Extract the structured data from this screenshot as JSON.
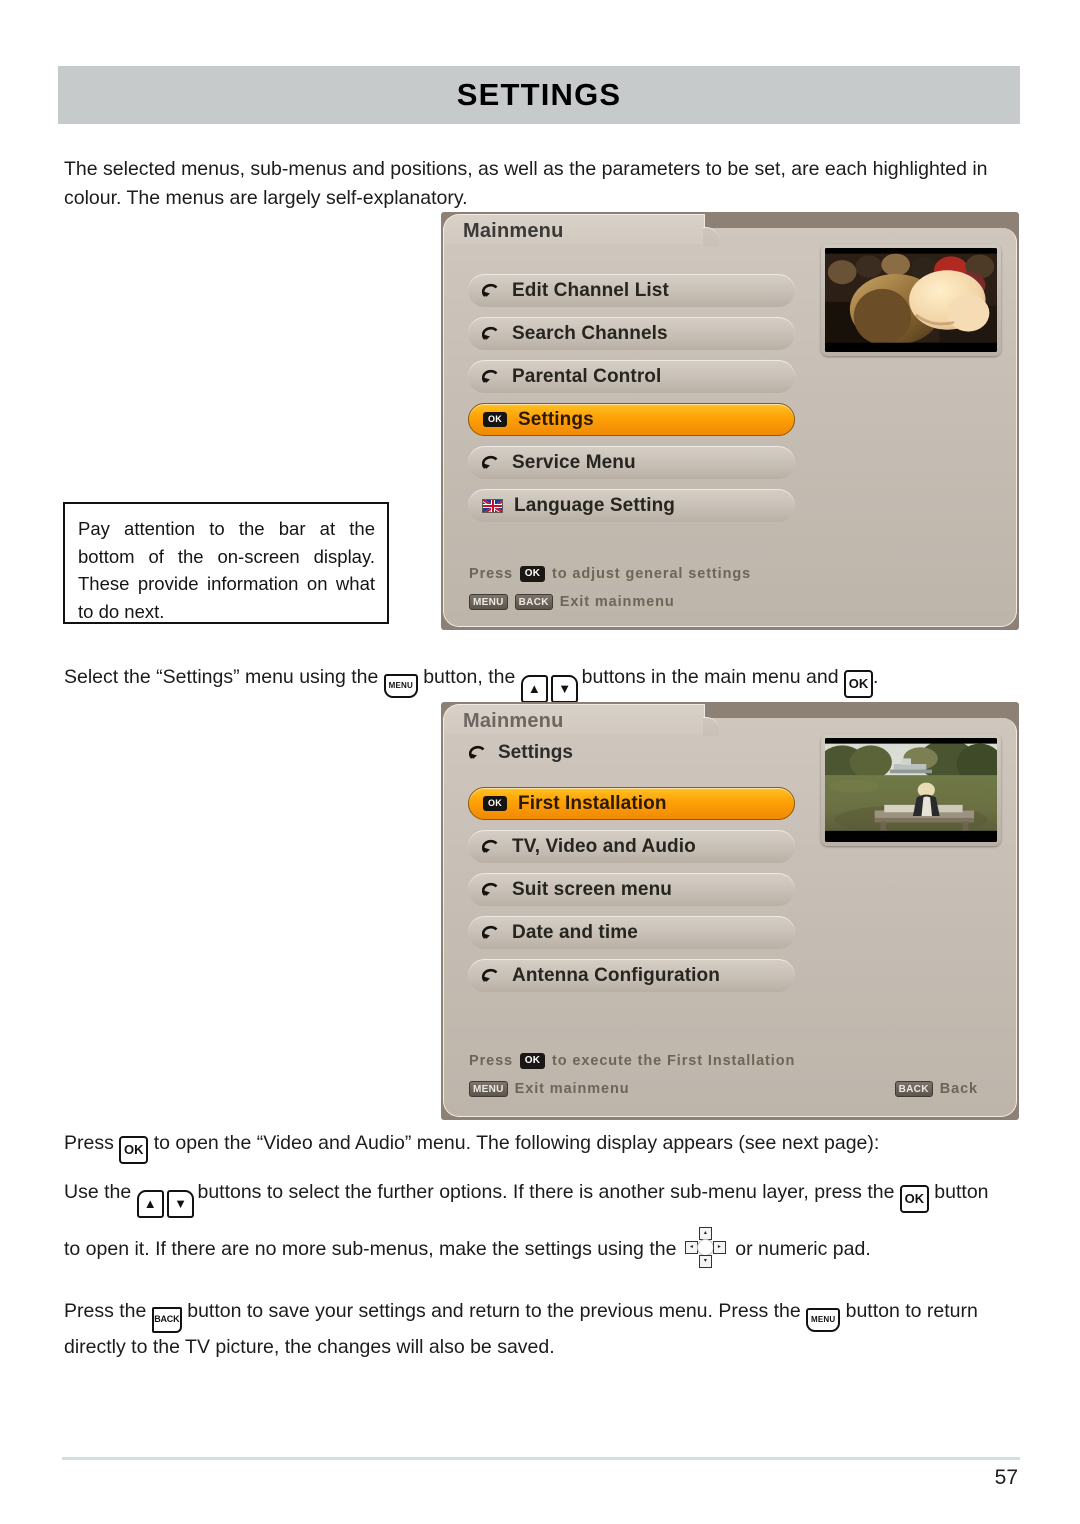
{
  "document": {
    "section_title": "SETTINGS",
    "page_number": "57",
    "intro_paragraph": "The selected menus, sub-menus and positions, as well as the parameters to be set, are each highlighted in colour. The menus are largely self-explanatory.",
    "note_box": "Pay attention to the bar at the bottom of the on-screen display. These provide information on what to do next.",
    "instructions": {
      "select_settings": {
        "part1": "Select the “Settings” menu using the",
        "part2": "button, the",
        "part3": "buttons in the main menu and",
        "part4": "."
      },
      "press_ok": {
        "part1": "Press",
        "part2": "to open the “Video and Audio” menu. The following display appears (see next page):"
      },
      "use_buttons": {
        "part1": "Use the",
        "part2": "buttons to select the further options. If there is another sub-menu layer, press the",
        "part3": "button"
      },
      "open_it": {
        "part1": "to open it. If there are no more sub-menus, make the settings using the",
        "part2": "or numeric pad."
      },
      "save_return": {
        "part1": "Press the",
        "part2": "button to save your settings and return to the previous menu. Press the",
        "part3": "button to return directly to the TV picture, the changes will also be saved."
      }
    },
    "keys": {
      "menu": "MENU",
      "ok": "OK",
      "back": "BACK",
      "up": "▲",
      "down": "▼",
      "navpad_up": "▴",
      "navpad_down": "▾",
      "navpad_left": "◂",
      "navpad_right": "▸"
    }
  },
  "osd_mainmenu": {
    "title": "Mainmenu",
    "items": [
      {
        "label": "Edit Channel List",
        "icon": "arrow-loop-icon",
        "selected": false
      },
      {
        "label": "Search Channels",
        "icon": "arrow-loop-icon",
        "selected": false
      },
      {
        "label": "Parental Control",
        "icon": "arrow-loop-icon",
        "selected": false
      },
      {
        "label": "Settings",
        "icon": "ok-badge-icon",
        "selected": true
      },
      {
        "label": "Service Menu",
        "icon": "arrow-loop-icon",
        "selected": false
      },
      {
        "label": "Language Setting",
        "icon": "uk-flag-icon",
        "selected": false
      }
    ],
    "status": {
      "line1_prefix": "Press",
      "line1_key": "OK",
      "line1_suffix": "to adjust general settings",
      "line2_key1": "MENU",
      "line2_key2": "BACK",
      "line2_text": "Exit mainmenu"
    },
    "preview": "crowd-scene-thumbnail",
    "colors": {
      "highlight": "#ffa207",
      "panel": "#c6beb4",
      "frame": "#8d8176"
    }
  },
  "osd_settings": {
    "title": "Mainmenu",
    "breadcrumb": "Settings",
    "items": [
      {
        "label": "First Installation",
        "icon": "ok-badge-icon",
        "selected": true
      },
      {
        "label": "TV, Video and Audio",
        "icon": "arrow-loop-icon",
        "selected": false
      },
      {
        "label": "Suit screen menu",
        "icon": "arrow-loop-icon",
        "selected": false
      },
      {
        "label": "Date and time",
        "icon": "arrow-loop-icon",
        "selected": false
      },
      {
        "label": "Antenna Configuration",
        "icon": "arrow-loop-icon",
        "selected": false
      }
    ],
    "status": {
      "line1_prefix": "Press",
      "line1_key": "OK",
      "line1_suffix": "to execute the First Installation",
      "line2_key1": "MENU",
      "line2_text": "Exit mainmenu",
      "line2_key2": "BACK",
      "line2_text2": "Back"
    },
    "preview": "park-bench-scene-thumbnail",
    "colors": {
      "highlight": "#ffa207",
      "panel": "#c6beb4",
      "frame": "#8d8176"
    }
  }
}
